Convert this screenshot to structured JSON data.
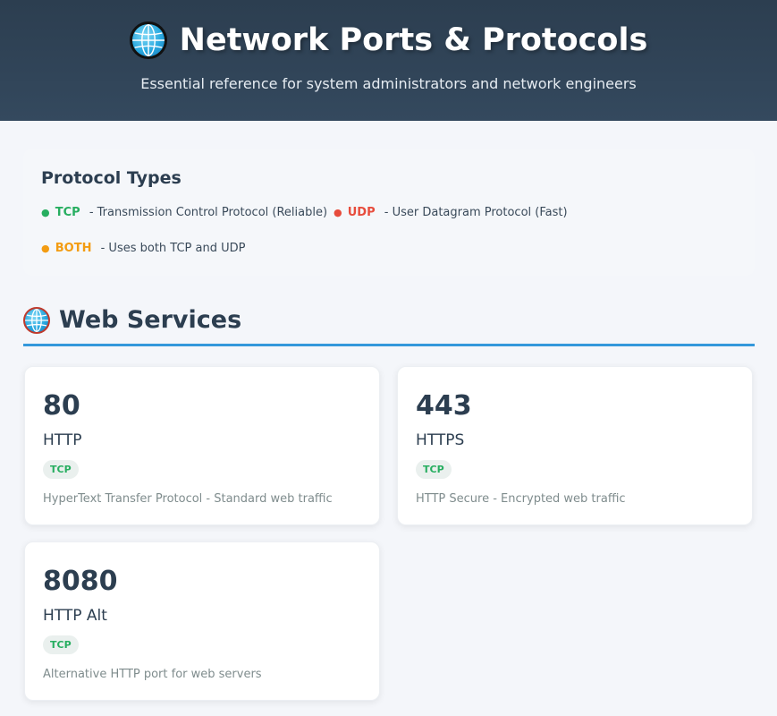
{
  "header": {
    "icon": "globe-icon",
    "title": "Network Ports & Protocols",
    "subtitle": "Essential reference for system administrators and network engineers"
  },
  "legend": {
    "title": "Protocol Types",
    "items": [
      {
        "tag": "TCP",
        "description": "- Transmission Control Protocol (Reliable)",
        "color": "#27ae60"
      },
      {
        "tag": "UDP",
        "description": "- User Datagram Protocol (Fast)",
        "color": "#e74c3c"
      },
      {
        "tag": "BOTH",
        "description": "- Uses both TCP and UDP",
        "color": "#f39c12"
      }
    ]
  },
  "section": {
    "icon": "globe-icon",
    "title": "Web Services",
    "accent": "#3498db",
    "cards": [
      {
        "port": "80",
        "service": "HTTP",
        "protocol": "TCP",
        "description": "HyperText Transfer Protocol - Standard web traffic"
      },
      {
        "port": "443",
        "service": "HTTPS",
        "protocol": "TCP",
        "description": "HTTP Secure - Encrypted web traffic"
      },
      {
        "port": "8080",
        "service": "HTTP Alt",
        "protocol": "TCP",
        "description": "Alternative HTTP port for web servers"
      }
    ]
  }
}
